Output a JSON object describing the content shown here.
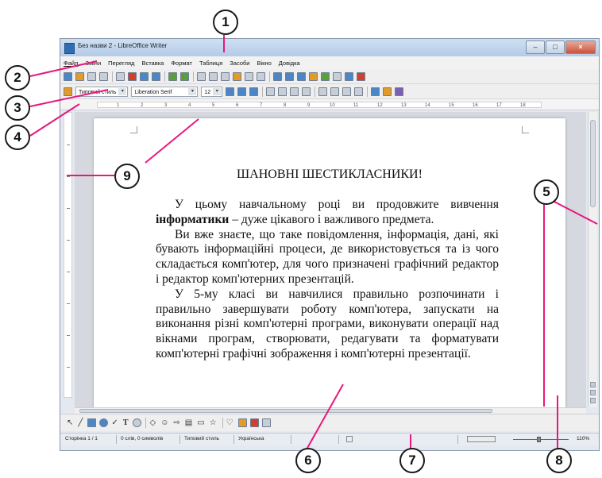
{
  "window": {
    "title": "Без назви 2 - LibreOffice Writer",
    "buttons": {
      "minimize": "–",
      "maximize": "□",
      "close": "×"
    }
  },
  "menu": [
    "Файл",
    "Зміни",
    "Перегляд",
    "Вставка",
    "Формат",
    "Таблиця",
    "Засоби",
    "Вікно",
    "Довідка"
  ],
  "formatting": {
    "style": "Типовий стиль",
    "font": "Liberation Serif",
    "size": "12"
  },
  "ruler_numbers": [
    "1",
    "2",
    "3",
    "4",
    "5",
    "6",
    "7",
    "8",
    "9",
    "10",
    "11",
    "12",
    "13",
    "14",
    "15",
    "16",
    "17",
    "18"
  ],
  "document": {
    "title": "ШАНОВНІ ШЕСТИКЛАСНИКИ!",
    "p1_before": "У цьому навчальному році ви продовжите вивчення ",
    "p1_bold": "інформатики",
    "p1_after": " – дуже цікавого і важливого предмета.",
    "p2": "Ви вже знаєте, що таке повідомлення, інформація, дані, які бувають інформаційні процеси, де використовується та із чого складається комп'ютер, для чого призначені графічний редактор і редактор комп'ютерних презентацій.",
    "p3": "У 5-му класі ви навчилися правильно розпочинати і правильно завершувати роботу комп'ютера, запускати на виконання різні комп'ютерні програми, виконувати операції над вікнами програм, створювати, редагувати та форматувати комп'ютерні графічні зображення і комп'ютерні презентації."
  },
  "status": {
    "page": "Сторінка 1 / 1",
    "words": "0 слів, 0 символів",
    "style": "Типовий стиль",
    "language": "Українська",
    "zoom": "110%"
  },
  "callouts": [
    "1",
    "2",
    "3",
    "4",
    "5",
    "6",
    "7",
    "8",
    "9"
  ],
  "colors": {
    "callout_line": "#e8177d",
    "accent": "#2f6db5"
  }
}
